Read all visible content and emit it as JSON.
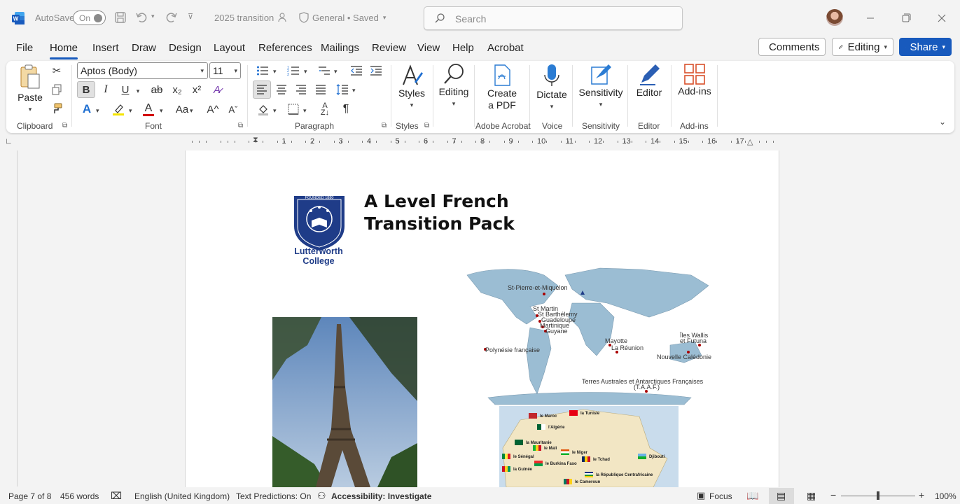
{
  "titlebar": {
    "autosave_label": "AutoSave",
    "autosave_state": "On",
    "doc_title": "2025 transition",
    "sensitivity_label": "General • Saved",
    "search_placeholder": "Search"
  },
  "menu": {
    "tabs": [
      "File",
      "Home",
      "Insert",
      "Draw",
      "Design",
      "Layout",
      "References",
      "Mailings",
      "Review",
      "View",
      "Help",
      "Acrobat"
    ],
    "active": "Home",
    "comments": "Comments",
    "editing": "Editing",
    "share": "Share"
  },
  "ribbon": {
    "paste": "Paste",
    "font_name": "Aptos (Body)",
    "font_size": "11",
    "bold": "B",
    "italic": "I",
    "underline": "U",
    "strike": "ab",
    "subscript": "x₂",
    "superscript": "x²",
    "case": "Aa",
    "grow": "A^",
    "shrink": "Aˇ",
    "styles": "Styles",
    "editing": "Editing",
    "create_pdf_1": "Create",
    "create_pdf_2": "a PDF",
    "dictate": "Dictate",
    "sensitivity": "Sensitivity",
    "editor": "Editor",
    "addins": "Add-ins",
    "groups": {
      "clipboard": "Clipboard",
      "font": "Font",
      "paragraph": "Paragraph",
      "styles": "Styles",
      "acrobat": "Adobe Acrobat",
      "voice": "Voice",
      "sensitivity": "Sensitivity",
      "editor": "Editor",
      "addins": "Add-ins"
    }
  },
  "ruler": {
    "numbers": [
      "1",
      "2",
      "3",
      "4",
      "5",
      "6",
      "7",
      "8",
      "9",
      "10",
      "11",
      "12",
      "13",
      "14",
      "15",
      "16",
      "17"
    ]
  },
  "document": {
    "heading_line1": "A Level French",
    "heading_line2": "Transition Pack",
    "crest_text_1": "Lutterworth",
    "crest_text_2": "College",
    "crest_founded": "FOUNDED 1880",
    "map_labels": {
      "st_pierre": "St-Pierre-et-Miquelon",
      "st_martin": "St Martin",
      "st_barth": "St Barthélemy",
      "guadeloupe": "Guadeloupe",
      "martinique": "Martinique",
      "guyane": "Guyane",
      "polynesie": "Polynésie française",
      "mayotte": "Mayotte",
      "reunion": "La Réunion",
      "wallis_1": "Îles Wallis",
      "wallis_2": "et Futuna",
      "caledonie": "Nouvelle Calédonie",
      "taaf_1": "Terres Australes et Antarctiques Françaises",
      "taaf_2": "(T.A.A.F.)"
    },
    "africa_labels": {
      "maroc": "le Maroc",
      "tunisie": "la Tunisie",
      "algerie": "l'Algérie",
      "mauritanie": "la Mauritanie",
      "mali": "le Mali",
      "niger": "le Niger",
      "senegal": "le Sénégal",
      "burkina": "le Burkina Faso",
      "tchad": "le Tchad",
      "djibouti": "Djibouti",
      "guinee": "la Guinée",
      "rca": "la République Centrafricaine",
      "cameroun": "le Cameroun"
    }
  },
  "statusbar": {
    "page": "Page 7 of 8",
    "words": "456 words",
    "language": "English (United Kingdom)",
    "predictions": "Text Predictions: On",
    "accessibility": "Accessibility: Investigate",
    "focus": "Focus",
    "zoom": "100%",
    "zoom_level": 1.0
  }
}
